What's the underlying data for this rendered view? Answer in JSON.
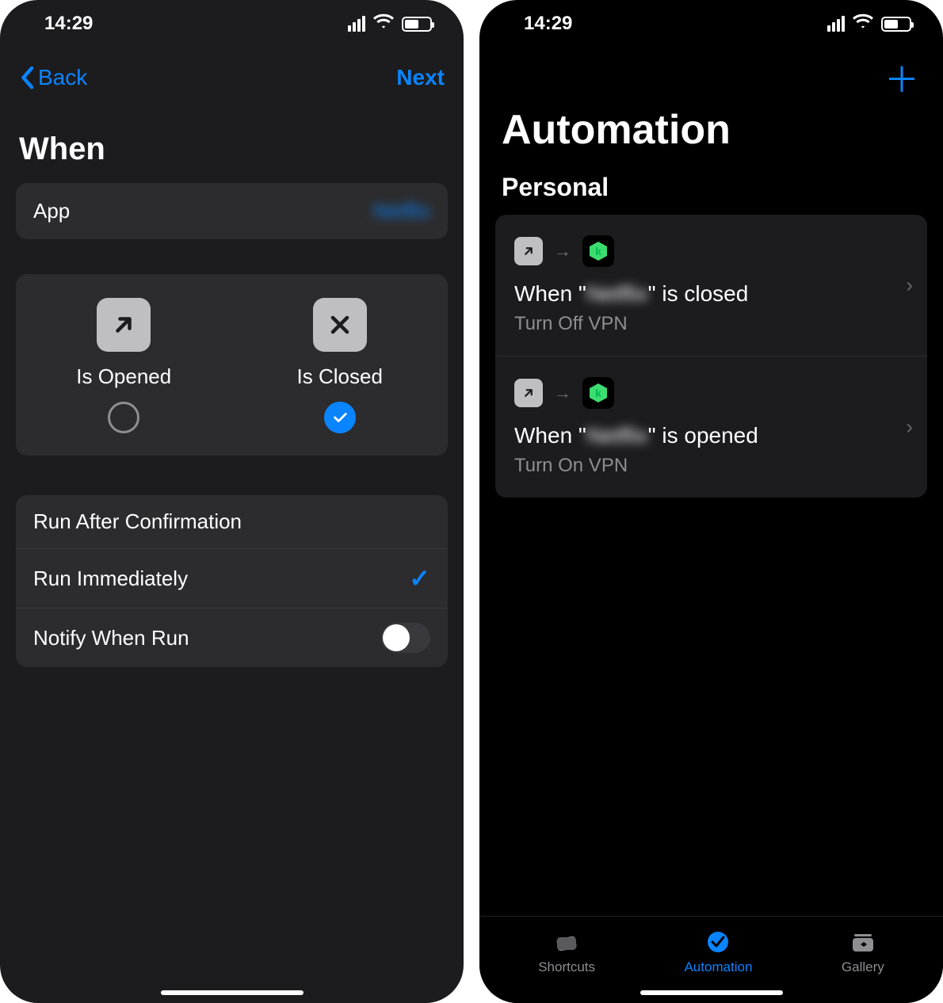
{
  "status": {
    "time": "14:29"
  },
  "left": {
    "nav": {
      "back": "Back",
      "next": "Next"
    },
    "when_title": "When",
    "app_row": {
      "label": "App",
      "value": "Netflix"
    },
    "triggers": {
      "opened": {
        "label": "Is Opened",
        "selected": false
      },
      "closed": {
        "label": "Is Closed",
        "selected": true
      }
    },
    "run_options": {
      "after_confirmation": "Run After Confirmation",
      "immediately": "Run Immediately",
      "notify": "Notify When Run",
      "immediately_selected": true,
      "notify_on": false
    }
  },
  "right": {
    "page_title": "Automation",
    "section": "Personal",
    "automations": [
      {
        "title_prefix": "When \"",
        "title_app": "Netflix",
        "title_suffix": "\" is closed",
        "subtitle": "Turn Off VPN"
      },
      {
        "title_prefix": "When \"",
        "title_app": "Netflix",
        "title_suffix": "\" is opened",
        "subtitle": "Turn On VPN"
      }
    ],
    "tabs": {
      "shortcuts": "Shortcuts",
      "automation": "Automation",
      "gallery": "Gallery"
    }
  }
}
